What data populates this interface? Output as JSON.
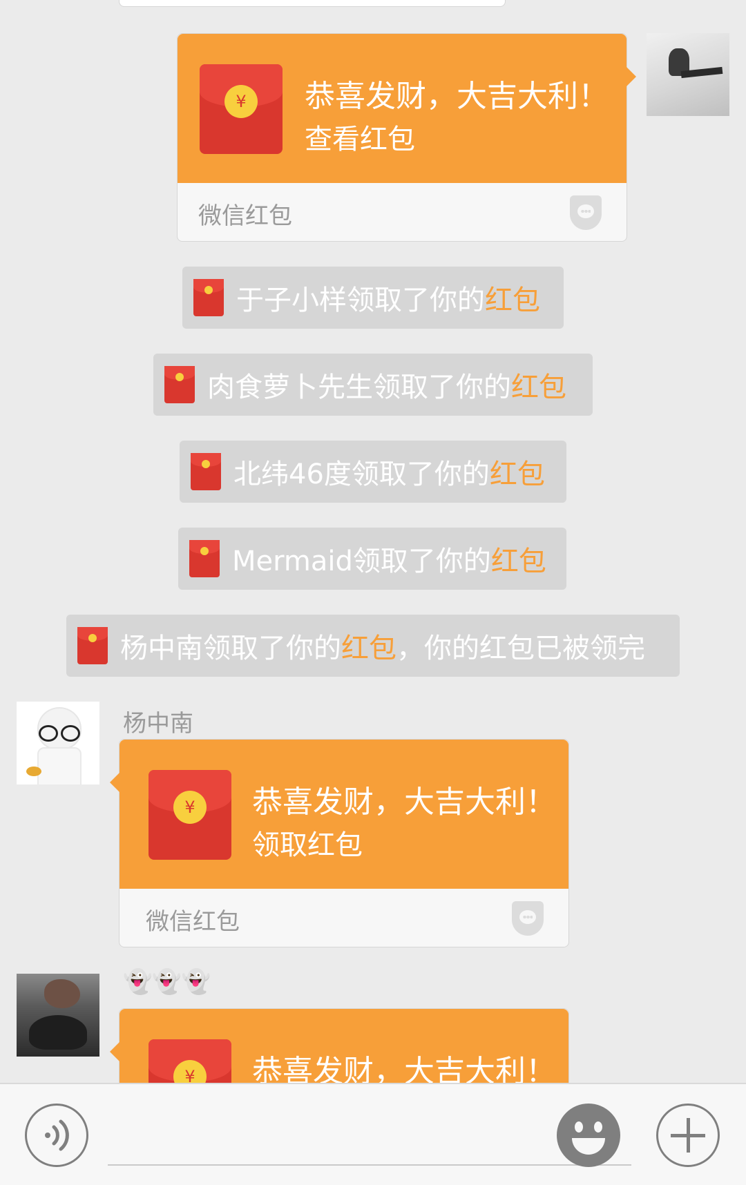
{
  "packets": [
    {
      "title": "恭喜发财，大吉大利！",
      "action": "查看红包",
      "brand": "微信红包"
    },
    {
      "title": "恭喜发财，大吉大利！",
      "action": "领取红包",
      "brand": "微信红包"
    },
    {
      "title": "恭喜发财，大吉大利！"
    }
  ],
  "coin_symbol": "¥",
  "notices": [
    {
      "text": "于子小样领取了你的",
      "highlight": "红包",
      "suffix": ""
    },
    {
      "text": "肉食萝卜先生领取了你的",
      "highlight": "红包",
      "suffix": ""
    },
    {
      "text": "北纬46度领取了你的",
      "highlight": "红包",
      "suffix": ""
    },
    {
      "text": "Mermaid领取了你的",
      "highlight": "红包",
      "suffix": ""
    },
    {
      "text": "杨中南领取了你的",
      "highlight": "红包",
      "suffix": "，你的红包已被领完"
    }
  ],
  "senders": [
    "杨中南",
    "👻👻👻"
  ],
  "colors": {
    "packet_orange": "#f79f39",
    "envelope_red": "#d9372e",
    "coin_yellow": "#f8cf3e",
    "background": "#ebebeb"
  },
  "icons": {
    "voice": "voice-icon",
    "emoji": "emoji-icon",
    "plus": "plus-icon",
    "shield": "shield-icon"
  }
}
